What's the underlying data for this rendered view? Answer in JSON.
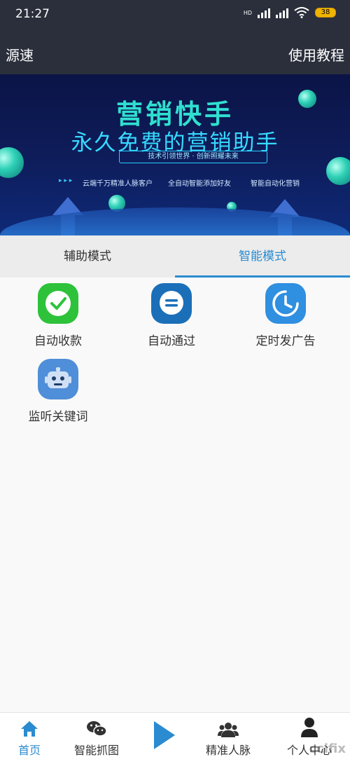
{
  "status_bar": {
    "time": "21:27",
    "network_label": "HD",
    "battery": "38"
  },
  "app_bar": {
    "left": "源速",
    "right": "使用教程"
  },
  "banner": {
    "title": "营销快手",
    "subtitle": "永久免费的营销助手",
    "slogan": "技术引领世界 · 创新照耀未来",
    "arrows": "▸ ▸ ▸",
    "features": [
      "云端千万精准人脉客户",
      "全自动智能添加好友",
      "智能自动化营销"
    ]
  },
  "tabs": [
    {
      "label": "辅助模式",
      "active": false
    },
    {
      "label": "智能模式",
      "active": true
    }
  ],
  "features": [
    {
      "label": "自动收款",
      "icon": "wechat-pay-icon",
      "color": "#2dc23a"
    },
    {
      "label": "自动通过",
      "icon": "message-bubble-icon",
      "color": "#1a6fb8"
    },
    {
      "label": "定时发广告",
      "icon": "clock-icon",
      "color": "#2f8fe0"
    },
    {
      "label": "监听关键词",
      "icon": "robot-icon",
      "color": "#4f8ed8"
    }
  ],
  "bottom_nav": [
    {
      "label": "首页",
      "icon": "home-icon",
      "active": true
    },
    {
      "label": "智能抓图",
      "icon": "wechat-icon",
      "active": false
    },
    {
      "label": "",
      "icon": "play-icon",
      "active": false
    },
    {
      "label": "精准人脉",
      "icon": "contacts-icon",
      "active": false
    },
    {
      "label": "个人中心",
      "icon": "person-icon",
      "active": false
    }
  ],
  "watermark": "ccifix",
  "colors": {
    "header_bg": "#2a2f3b",
    "accent": "#2a8bd0",
    "banner_bg": "#0e1d5c"
  }
}
